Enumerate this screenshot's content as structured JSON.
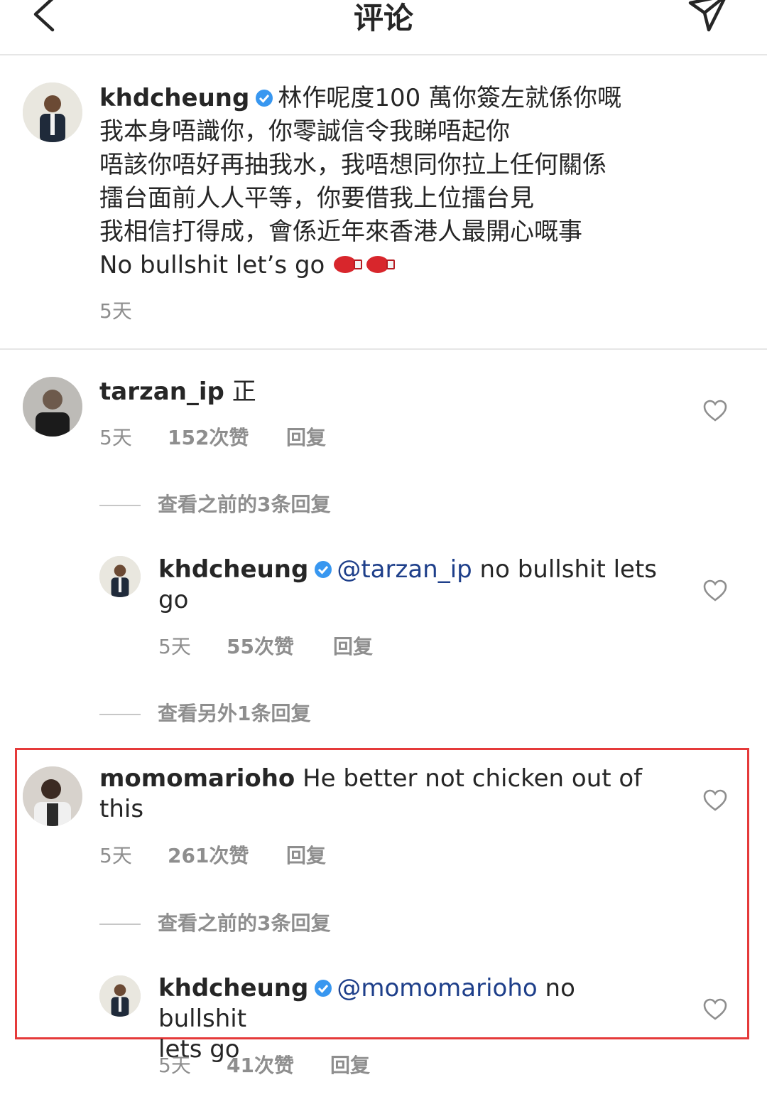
{
  "header": {
    "title": "评论"
  },
  "caption": {
    "username": "khdcheung",
    "lines": [
      "林作呢度100 萬你簽左就係你嘅",
      "我本身唔識你，你零誠信令我睇唔起你",
      "唔該你唔好再抽我水，我唔想同你拉上任何關係",
      "擂台面前人人平等，你要借我上位擂台見",
      "我相信打得成，會係近年來香港人最開心嘅事",
      "No bullshit let’s go"
    ],
    "emoji": [
      "boxing-glove",
      "boxing-glove"
    ],
    "time": "5天"
  },
  "comments": [
    {
      "username": "tarzan_ip",
      "text": "正",
      "time": "5天",
      "likes": "152次赞",
      "reply_label": "回复",
      "view_replies": "查看之前的3条回复",
      "reply": {
        "username": "khdcheung",
        "mention": "@tarzan_ip",
        "text_line1": "no bullshit lets",
        "text_line2": "go",
        "time": "5天",
        "likes": "55次赞",
        "reply_label": "回复"
      },
      "view_more": "查看另外1条回复"
    },
    {
      "username": "momomarioho",
      "text_line1": "He better not chicken out of",
      "text_line2": "this",
      "time": "5天",
      "likes": "261次赞",
      "reply_label": "回复",
      "view_replies": "查看之前的3条回复",
      "reply": {
        "username": "khdcheung",
        "mention": "@momomarioho",
        "text_line1": "no bullshit",
        "text_line2": "lets go",
        "time": "5天",
        "likes": "41次赞",
        "reply_label": "回复"
      }
    }
  ],
  "colors": {
    "highlight": "#e53a3a",
    "verified": "#3897f0",
    "mention": "#1e3f8a",
    "muted": "#8e8e8e"
  },
  "icons": [
    "back-chevron-icon",
    "send-icon",
    "heart-icon",
    "verified-badge-icon"
  ]
}
